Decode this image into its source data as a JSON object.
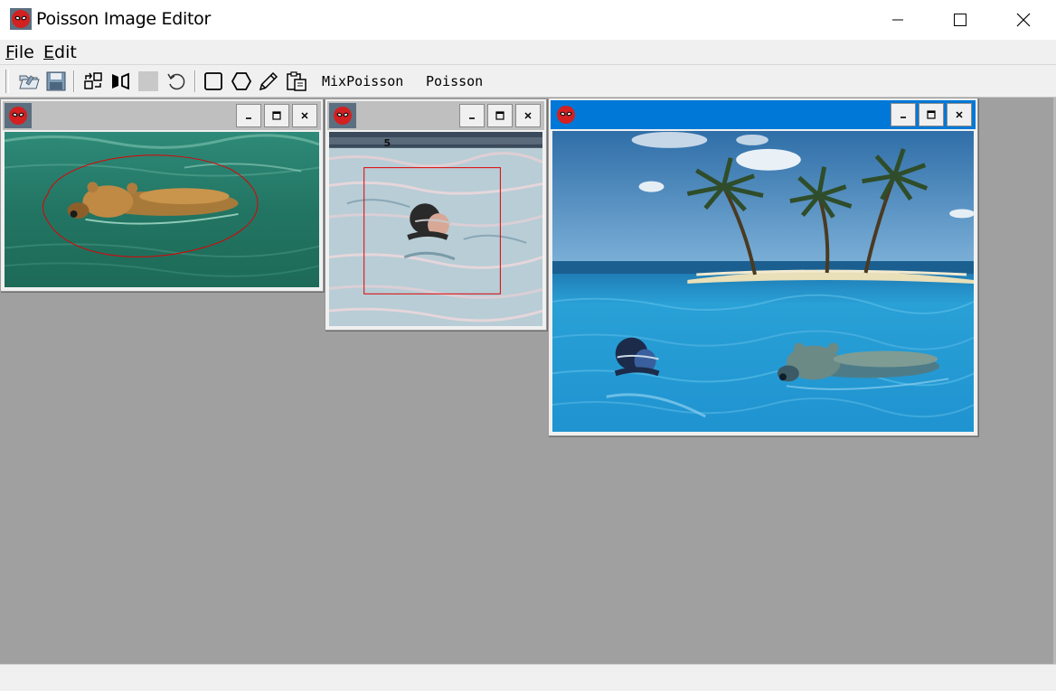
{
  "window": {
    "title": "Poisson Image Editor",
    "controls": [
      "minimize",
      "maximize",
      "close"
    ]
  },
  "menu": {
    "file": {
      "accel": "F",
      "rest": "ile"
    },
    "edit": {
      "accel": "E",
      "rest": "dit"
    }
  },
  "toolbar": {
    "icons": [
      "open-folder-icon",
      "save-icon",
      "swap-icon",
      "flip-icon",
      "blank-icon",
      "rotate-icon",
      "rectangle-icon",
      "polygon-icon",
      "pencil-icon",
      "paste-icon"
    ],
    "mix_poisson_label": "MixPoisson",
    "poisson_label": "Poisson"
  },
  "children": [
    {
      "id": "bear",
      "state": "inactive",
      "content": "bear swimming in green water with freehand red selection"
    },
    {
      "id": "swimmer",
      "state": "inactive",
      "content": "swimmer in pool with red rectangle selection",
      "lane_number": "5"
    },
    {
      "id": "result",
      "state": "active",
      "content": "tropical island and blue sea with blended swimmer and bear"
    }
  ],
  "colors": {
    "active_caption": "#0078d7",
    "inactive_caption": "#bfbfbf",
    "workspace": "#a0a0a0",
    "selection": "#e00000"
  }
}
